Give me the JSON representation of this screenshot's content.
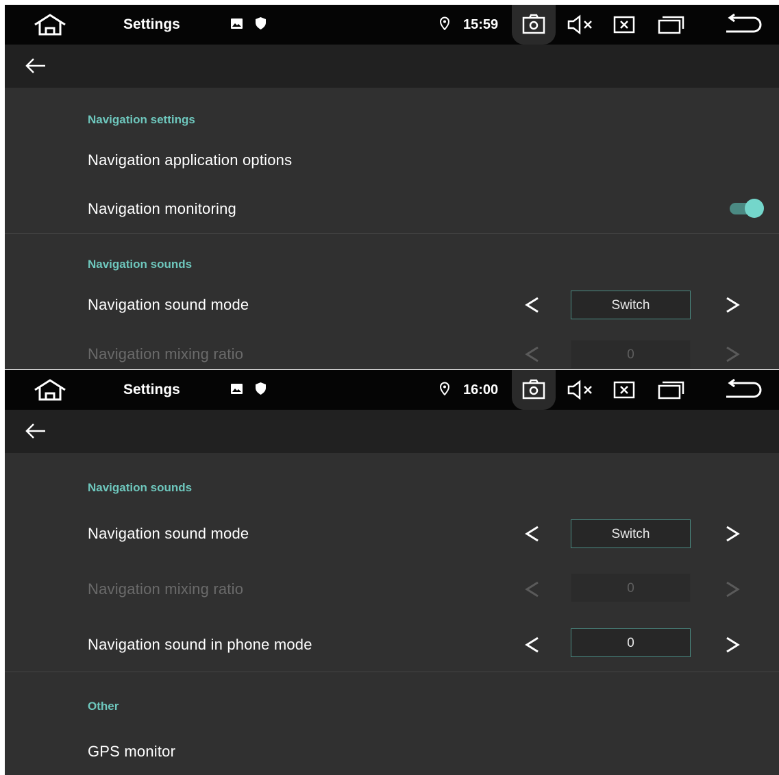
{
  "colors": {
    "accent": "#6ec7bd",
    "status_bar": "#050505",
    "app_bar": "#212121",
    "background": "#303030"
  },
  "panels": [
    {
      "status_bar": {
        "title": "Settings",
        "time": "15:59"
      },
      "sections": [
        {
          "title": "Navigation settings",
          "rows": [
            {
              "label": "Navigation application options"
            },
            {
              "label": "Navigation monitoring",
              "toggle": true
            }
          ]
        },
        {
          "title": "Navigation sounds",
          "rows": [
            {
              "label": "Navigation sound mode",
              "value": "Switch"
            },
            {
              "label": "Navigation mixing ratio",
              "value": "0",
              "disabled": true
            }
          ]
        }
      ]
    },
    {
      "status_bar": {
        "title": "Settings",
        "time": "16:00"
      },
      "sections": [
        {
          "title": "Navigation sounds",
          "rows": [
            {
              "label": "Navigation sound mode",
              "value": "Switch"
            },
            {
              "label": "Navigation mixing ratio",
              "value": "0",
              "disabled": true
            },
            {
              "label": "Navigation sound in phone mode",
              "value": "0"
            }
          ]
        },
        {
          "title": "Other",
          "rows": [
            {
              "label": "GPS monitor"
            }
          ]
        }
      ]
    }
  ]
}
